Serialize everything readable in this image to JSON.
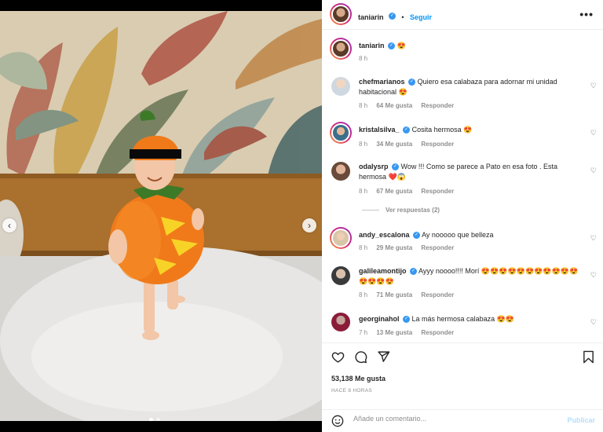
{
  "post": {
    "author": "taniarin",
    "author_emoji": "😍",
    "follow_label": "Seguir",
    "more_label": "•••",
    "caption_time": "8 h"
  },
  "carousel": {
    "prev": "‹",
    "next": "›"
  },
  "comments": [
    {
      "user": "chefmarianos",
      "text": "Quiero esa calabaza para adornar mi unidad habitacional 😍",
      "time": "8 h",
      "likes": "64 Me gusta",
      "reply": "Responder"
    },
    {
      "user": "kristalsilva_",
      "text": "Cosita hermosa 😍",
      "time": "8 h",
      "likes": "34 Me gusta",
      "reply": "Responder"
    },
    {
      "user": "odalysrp",
      "text": "Wow !!! Como se parece a Pato en esa foto . Esta hermosa ❤️😱",
      "time": "8 h",
      "likes": "67 Me gusta",
      "reply": "Responder"
    },
    {
      "user": "andy_escalona",
      "text": "Ay nooooo que belleza",
      "time": "8 h",
      "likes": "29 Me gusta",
      "reply": "Responder"
    },
    {
      "user": "galileamontijo",
      "text": "Ayyy noooo!!!! Morí 😍😍😍😍😍😍😍😍😍😍😍😍😍😍😍",
      "time": "8 h",
      "likes": "71 Me gusta",
      "reply": "Responder"
    },
    {
      "user": "georginahol",
      "text": "La más hermosa calabaza 😍😍",
      "time": "7 h",
      "likes": "13 Me gusta",
      "reply": "Responder"
    }
  ],
  "view_replies": "Ver respuestas (2)",
  "footer": {
    "likes_count": "53,138 Me gusta",
    "posted_ago": "HACE 8 HORAS",
    "comment_placeholder": "Añade un comentario...",
    "publish_label": "Publicar"
  },
  "colors": {
    "accent": "#0095f6",
    "verified": "#3897f0",
    "pumpkin": "#f07a1a"
  },
  "icons": [
    "heart-icon",
    "comment-icon",
    "share-icon",
    "bookmark-icon",
    "emoji-icon",
    "verified-icon"
  ]
}
